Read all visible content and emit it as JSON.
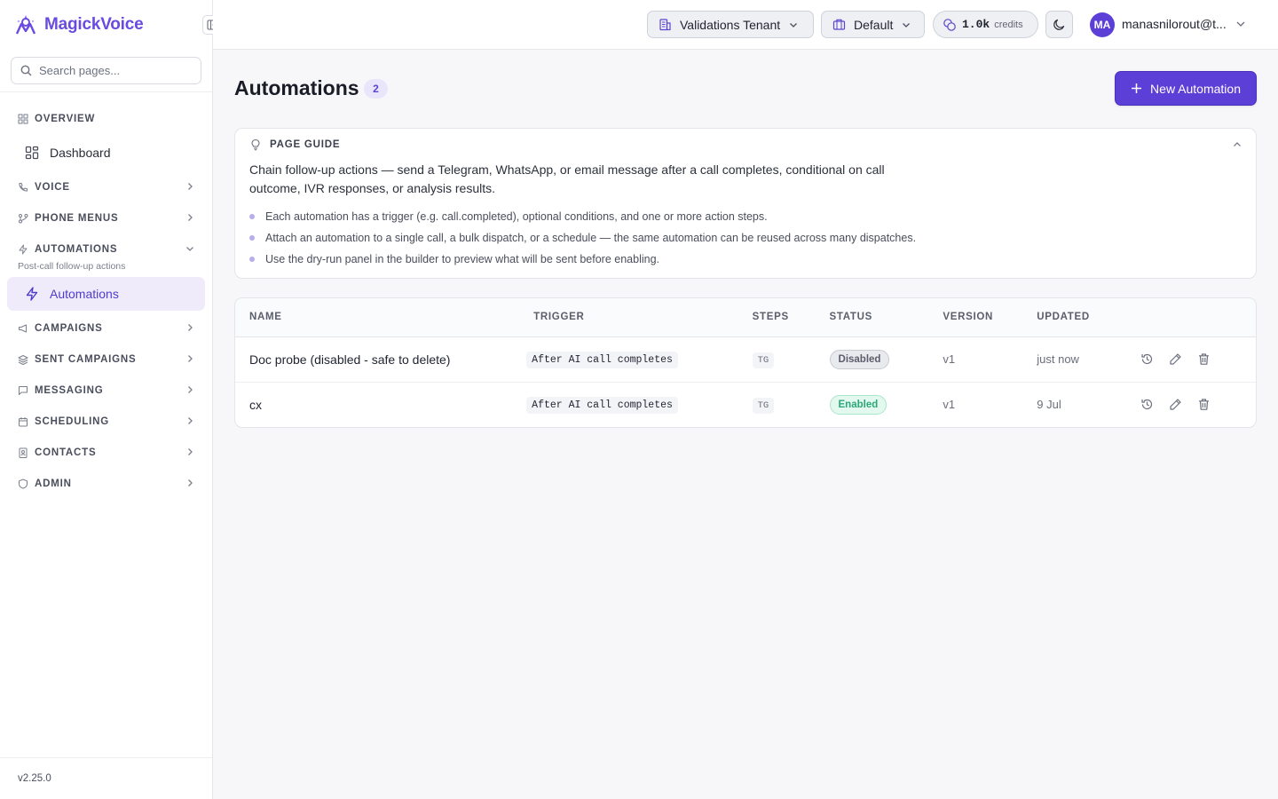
{
  "app": {
    "name": "MagickVoice",
    "version": "v2.25.0"
  },
  "search": {
    "placeholder": "Search pages..."
  },
  "sidebar": {
    "overview": {
      "label": "OVERVIEW",
      "items": [
        {
          "label": "Dashboard"
        }
      ]
    },
    "voice": {
      "label": "VOICE"
    },
    "phone_menus": {
      "label": "PHONE MENUS"
    },
    "automations": {
      "label": "AUTOMATIONS",
      "subtitle": "Post-call follow-up actions",
      "items": [
        {
          "label": "Automations"
        }
      ]
    },
    "campaigns": {
      "label": "CAMPAIGNS"
    },
    "sent_campaigns": {
      "label": "SENT CAMPAIGNS"
    },
    "messaging": {
      "label": "MESSAGING"
    },
    "scheduling": {
      "label": "SCHEDULING"
    },
    "contacts": {
      "label": "CONTACTS"
    },
    "admin": {
      "label": "ADMIN"
    }
  },
  "topbar": {
    "tenant": "Validations Tenant",
    "workspace": "Default",
    "credits_value": "1.0k",
    "credits_label": "credits",
    "avatar_initials": "MA",
    "user_email": "manasnilorout@t..."
  },
  "page": {
    "title": "Automations",
    "count": "2",
    "new_button": "New Automation"
  },
  "guide": {
    "title": "PAGE GUIDE",
    "description": "Chain follow-up actions — send a Telegram, WhatsApp, or email message after a call completes, conditional on call outcome, IVR responses, or analysis results.",
    "bullets": [
      "Each automation has a trigger (e.g. call.completed), optional conditions, and one or more action steps.",
      "Attach an automation to a single call, a bulk dispatch, or a schedule — the same automation can be reused across many dispatches.",
      "Use the dry-run panel in the builder to preview what will be sent before enabling."
    ]
  },
  "table": {
    "columns": [
      "NAME",
      "TRIGGER",
      "STEPS",
      "STATUS",
      "VERSION",
      "UPDATED"
    ],
    "rows": [
      {
        "name": "Doc probe (disabled - safe to delete)",
        "trigger": "After AI call completes",
        "steps": "TG",
        "status": "Disabled",
        "version": "v1",
        "updated": "just now"
      },
      {
        "name": "cx",
        "trigger": "After AI call completes",
        "steps": "TG",
        "status": "Enabled",
        "version": "v1",
        "updated": "9 Jul"
      }
    ]
  },
  "colors": {
    "accent": "#5b3fd6",
    "brand": "#6a4be0",
    "active_bg": "#efebfb",
    "enabled": "#2aa978",
    "disabled": "#5a5e6b"
  },
  "icons": [
    "magickvoice-logo-icon",
    "sidebar-collapse-icon",
    "search-icon",
    "overview-icon",
    "dashboard-icon",
    "phone-icon",
    "phone-menu-icon",
    "lightning-icon",
    "megaphone-icon",
    "layers-icon",
    "chat-icon",
    "calendar-icon",
    "contacts-icon",
    "shield-icon",
    "chevron-right-icon",
    "chevron-down-icon",
    "building-icon",
    "briefcase-icon",
    "coins-icon",
    "moon-icon",
    "plus-icon",
    "lightbulb-icon",
    "chevron-up-icon",
    "history-icon",
    "pencil-icon",
    "trash-icon"
  ]
}
